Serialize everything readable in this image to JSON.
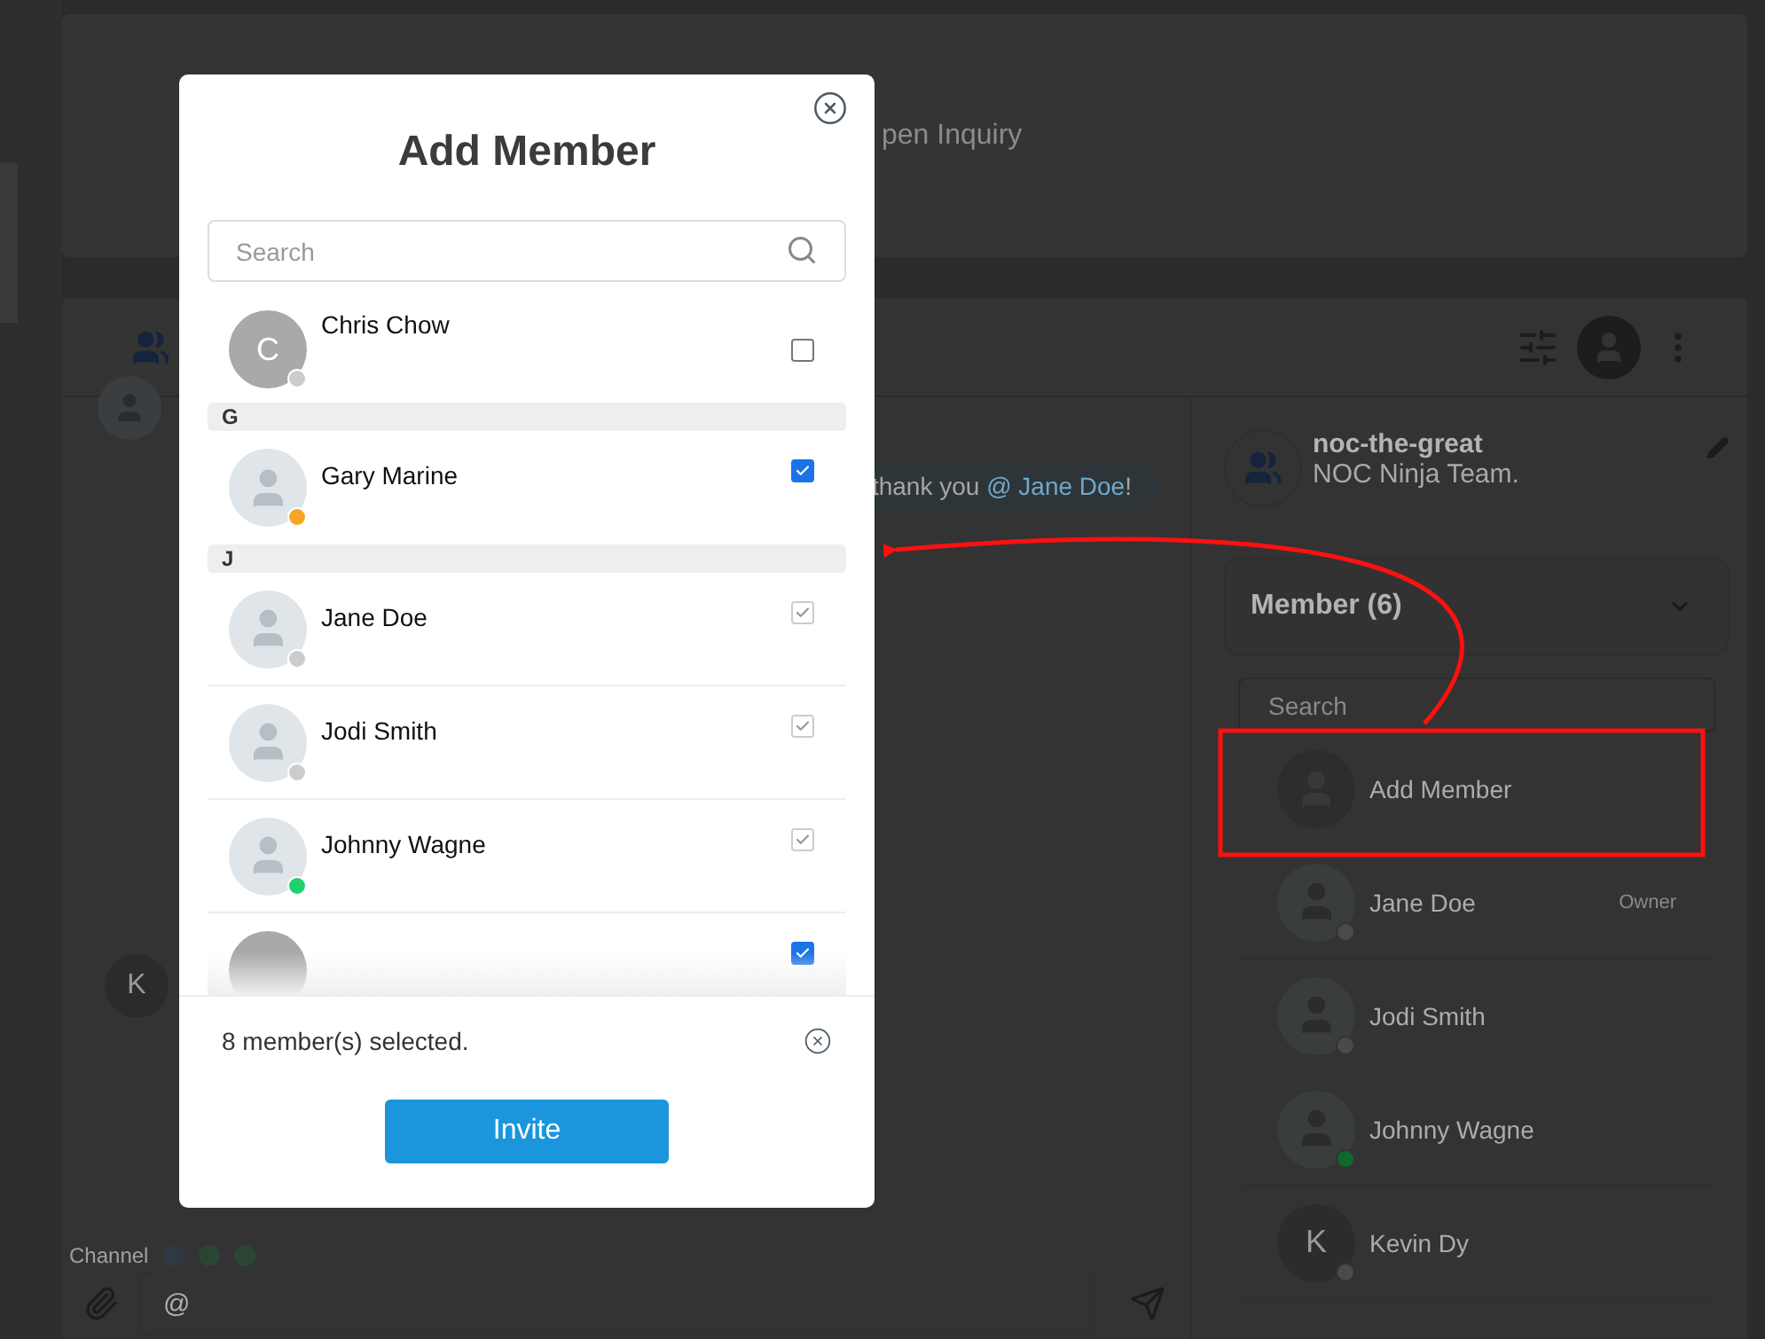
{
  "background": {
    "top_card": {
      "text": "pen Inquiry"
    },
    "chat": {
      "message": {
        "text": "thank you ",
        "mention": "@ Jane Doe",
        "end": "!"
      },
      "avatar_initial": "K",
      "channel_label": "Channel",
      "composer_value": "@"
    },
    "details": {
      "group_name": "noc-the-great",
      "group_description": "NOC Ninja Team.",
      "members_heading": "Member (6)",
      "search_placeholder": "Search",
      "add_member": "Add Member",
      "members": [
        {
          "name": "Jane Doe",
          "role": "Owner",
          "photo": true,
          "color": "#4a4a4a"
        },
        {
          "name": "Jodi Smith",
          "photo": true,
          "color": "#4a4a4a"
        },
        {
          "name": "Johnny Wagne",
          "photo": true,
          "color": "#0c6b2c"
        },
        {
          "name": "Kevin Dy",
          "photo": false,
          "initial": "K",
          "color": "#4a4a4a"
        }
      ]
    }
  },
  "dialog": {
    "title": "Add Member",
    "search_placeholder": "Search",
    "items": [
      {
        "kind": "contact",
        "name": "Chris Chow",
        "photo": false,
        "initial": "C",
        "color": "#cccccc",
        "checked": false,
        "disabled": false
      },
      {
        "kind": "section",
        "label": "G"
      },
      {
        "kind": "contact",
        "name": "Gary Marine",
        "photo": true,
        "color": "#f5a623",
        "checked": true,
        "disabled": false
      },
      {
        "kind": "section",
        "label": "J"
      },
      {
        "kind": "contact",
        "name": "Jane Doe",
        "photo": true,
        "color": "#cccccc",
        "checked": true,
        "disabled": true
      },
      {
        "kind": "contact",
        "name": "Jodi Smith",
        "photo": true,
        "color": "#cccccc",
        "checked": true,
        "disabled": true
      },
      {
        "kind": "contact",
        "name": "Johnny Wagne",
        "photo": true,
        "color": "#1fd16b",
        "checked": true,
        "disabled": true
      },
      {
        "kind": "contact",
        "photo": false,
        "checked": true,
        "disabled": false
      }
    ],
    "selection_summary": "8 member(s) selected.",
    "invite_button": "Invite"
  }
}
